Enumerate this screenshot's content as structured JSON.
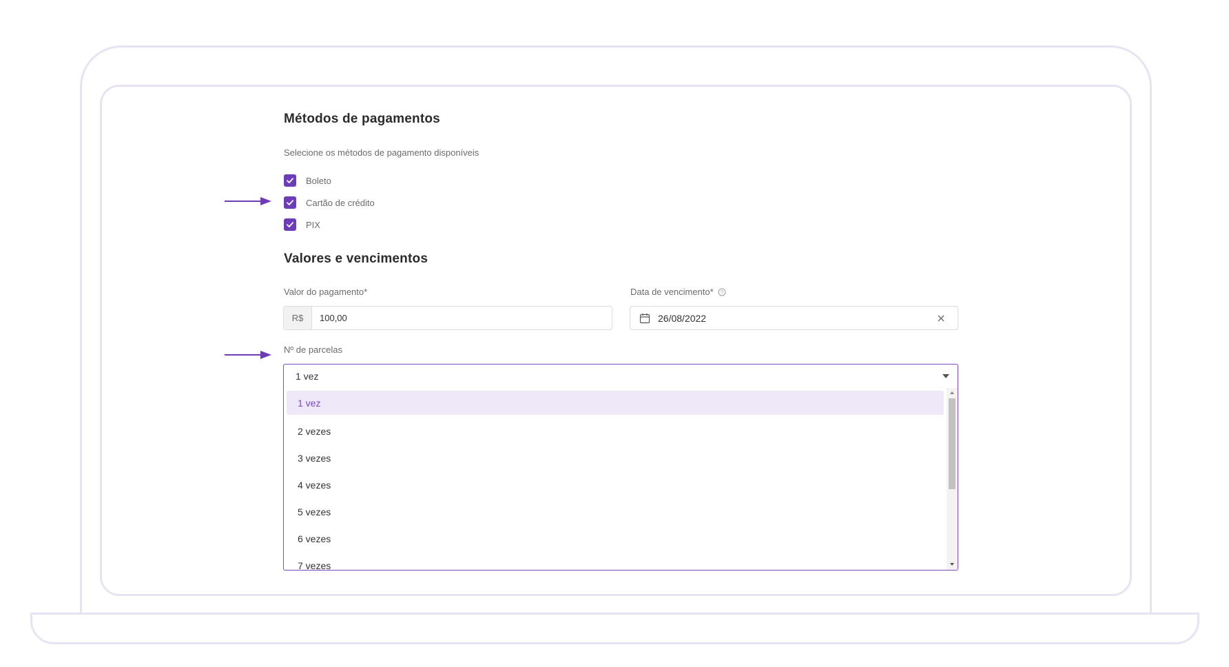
{
  "payment_methods": {
    "title": "Métodos de pagamentos",
    "subtitle": "Selecione os métodos de pagamento disponíveis",
    "options": [
      {
        "label": "Boleto",
        "checked": true
      },
      {
        "label": "Cartão de crédito",
        "checked": true
      },
      {
        "label": "PIX",
        "checked": true
      }
    ]
  },
  "values": {
    "title": "Valores e vencimentos",
    "amount_label": "Valor do pagamento*",
    "currency_prefix": "R$",
    "amount_value": "100,00",
    "due_date_label": "Data de vencimento*",
    "due_date_value": "26/08/2022",
    "installments_label": "Nº de parcelas",
    "installments_selected": "1 vez",
    "installment_options": [
      "1 vez",
      "2 vezes",
      "3 vezes",
      "4 vezes",
      "5 vezes",
      "6 vezes",
      "7 vezes"
    ]
  },
  "colors": {
    "accent": "#6f3cb7",
    "selected_bg": "#efe8f8",
    "frame": "#e8e3f2"
  },
  "icons": [
    "check-icon",
    "arrow-right-icon",
    "help-circle-icon",
    "calendar-icon",
    "close-icon",
    "caret-down-icon"
  ]
}
